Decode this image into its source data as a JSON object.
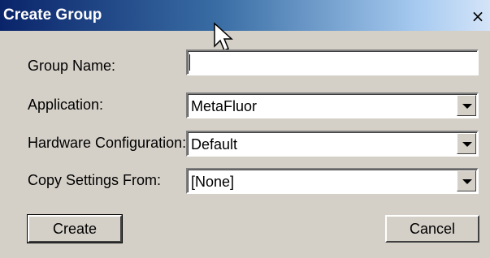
{
  "window": {
    "title": "Create Group",
    "close_glyph": "×"
  },
  "form": {
    "group_name": {
      "label": "Group Name:",
      "value": ""
    },
    "application": {
      "label": "Application:",
      "value": "MetaFluor"
    },
    "hardware": {
      "label": "Hardware Configuration:",
      "value": "Default"
    },
    "copy_settings": {
      "label": "Copy Settings From:",
      "value": "[None]"
    }
  },
  "buttons": {
    "create": "Create",
    "cancel": "Cancel"
  }
}
